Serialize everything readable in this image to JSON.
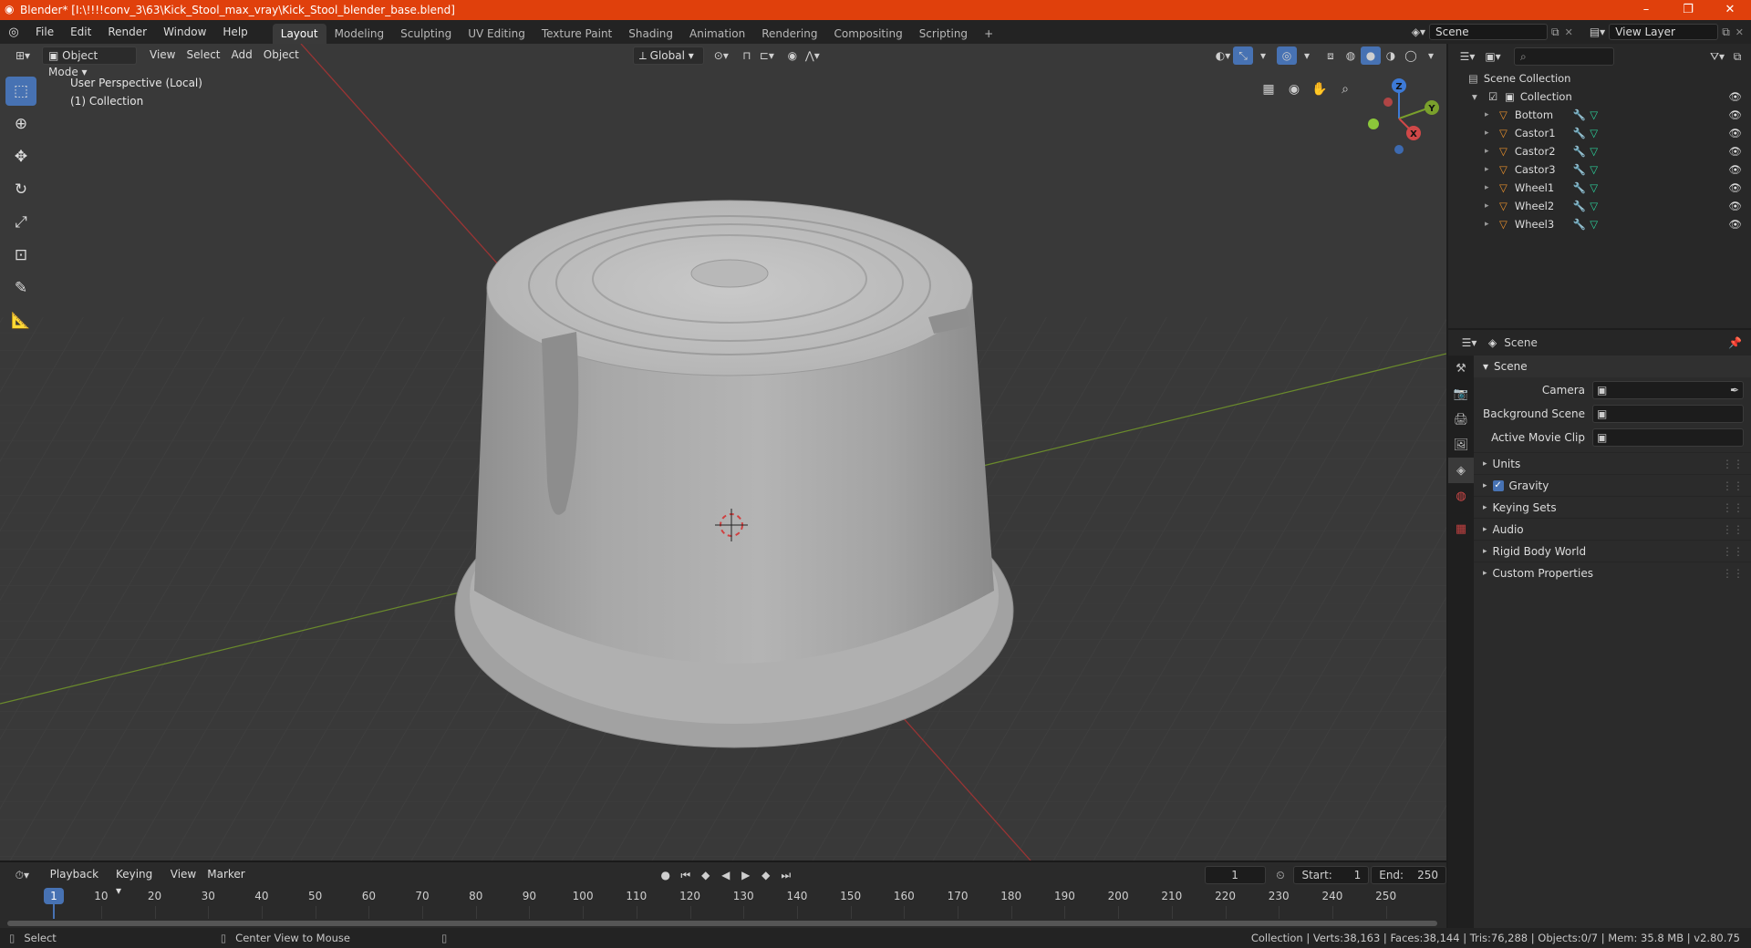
{
  "window": {
    "title": "Blender* [I:\\!!!!conv_3\\63\\Kick_Stool_max_vray\\Kick_Stool_blender_base.blend]",
    "minimize": "–",
    "restore": "❐",
    "close": "✕"
  },
  "menu": [
    "File",
    "Edit",
    "Render",
    "Window",
    "Help"
  ],
  "workspaces": [
    "Layout",
    "Modeling",
    "Sculpting",
    "UV Editing",
    "Texture Paint",
    "Shading",
    "Animation",
    "Rendering",
    "Compositing",
    "Scripting"
  ],
  "active_workspace": "Layout",
  "add_workspace": "+",
  "scene_name": "Scene",
  "view_layer": "View Layer",
  "viewport": {
    "mode": "Object Mode",
    "menus": [
      "View",
      "Select",
      "Add",
      "Object"
    ],
    "transform": "Global",
    "perspective_label": "User Perspective (Local)",
    "collection_label": "(1) Collection",
    "gizmo_axes": {
      "x": "X",
      "y": "Y",
      "z": "Z"
    }
  },
  "outliner": {
    "root": "Scene Collection",
    "collection": "Collection",
    "objects": [
      "Bottom",
      "Castor1",
      "Castor2",
      "Castor3",
      "Wheel1",
      "Wheel2",
      "Wheel3"
    ]
  },
  "properties": {
    "header": "Scene",
    "panel": "Scene",
    "fields": [
      {
        "label": "Camera"
      },
      {
        "label": "Background Scene"
      },
      {
        "label": "Active Movie Clip"
      }
    ],
    "sections": [
      {
        "label": "Units",
        "checkbox": false
      },
      {
        "label": "Gravity",
        "checkbox": true
      },
      {
        "label": "Keying Sets",
        "checkbox": false
      },
      {
        "label": "Audio",
        "checkbox": false
      },
      {
        "label": "Rigid Body World",
        "checkbox": false
      },
      {
        "label": "Custom Properties",
        "checkbox": false
      }
    ]
  },
  "timeline": {
    "menus": [
      "Playback",
      "Keying",
      "View",
      "Marker"
    ],
    "current_frame": "1",
    "start_label": "Start:",
    "start": "1",
    "end_label": "End:",
    "end": "250",
    "ticks": [
      "10",
      "20",
      "30",
      "40",
      "50",
      "60",
      "70",
      "80",
      "90",
      "100",
      "110",
      "120",
      "130",
      "140",
      "150",
      "160",
      "170",
      "180",
      "190",
      "200",
      "210",
      "220",
      "230",
      "240",
      "250"
    ],
    "playhead": "1"
  },
  "statusbar": {
    "left": "Select",
    "middle": "Center View to Mouse",
    "right": "Collection | Verts:38,163 | Faces:38,144 | Tris:76,288 | Objects:0/7 | Mem: 35.8 MB | v2.80.75"
  }
}
